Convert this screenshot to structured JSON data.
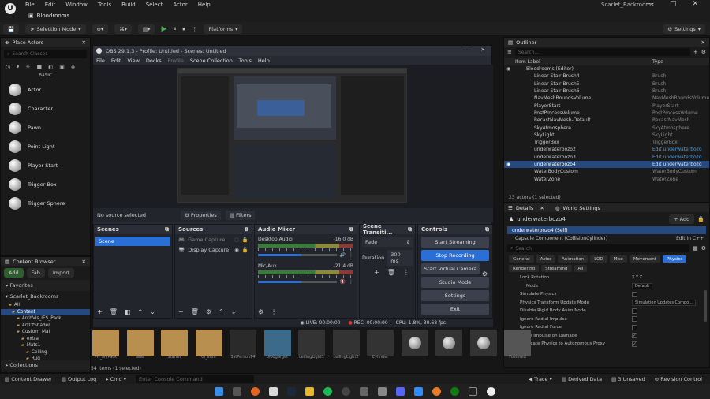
{
  "ue": {
    "logo": "U",
    "menu": [
      "File",
      "Edit",
      "Window",
      "Tools",
      "Build",
      "Select",
      "Actor",
      "Help"
    ],
    "project_tab": "Bloodrooms",
    "window_title": "Scarlet_Backrooms",
    "toolbar": {
      "selection_mode": "Selection Mode",
      "platforms": "Platforms",
      "settings": "Settings"
    }
  },
  "place_actors": {
    "title": "Place Actors",
    "search_placeholder": "Search Classes",
    "category": "BASIC",
    "items": [
      "Actor",
      "Character",
      "Pawn",
      "Point Light",
      "Player Start",
      "Trigger Box",
      "Trigger Sphere"
    ]
  },
  "content_browser": {
    "title": "Content Browser",
    "add": "Add",
    "fab": "Fab",
    "import": "Import",
    "favorites": "Favorites",
    "project": "Scarlet_Backrooms",
    "tree": [
      "All",
      "Content",
      "ArchVis_IES_Pack",
      "ArtOfShader",
      "Custom_Mat",
      "extra",
      "Mats1",
      "Ceiling",
      "Rug"
    ],
    "collections": "Collections",
    "item_count": "54 items (1 selected)",
    "thumb_labels": [
      "PN_IvyPack",
      "ade",
      "Starter",
      "UI_stuff",
      "1stPerson14",
      "biodgarget",
      "ceilingLight1",
      "ceilingLight2",
      "Cylinder",
      "",
      "",
      "",
      "Fostered"
    ]
  },
  "outliner": {
    "title": "Outliner",
    "search_placeholder": "Search...",
    "col_label": "Item Label",
    "col_type": "Type",
    "rows": [
      {
        "label": "Bloodrooms (Editor)",
        "type": ""
      },
      {
        "label": "Linear Stair Brush4",
        "type": "Brush"
      },
      {
        "label": "Linear Stair Brush5",
        "type": "Brush"
      },
      {
        "label": "Linear Stair Brush6",
        "type": "Brush"
      },
      {
        "label": "NavMeshBoundsVolume",
        "type": "NavMeshBoundsVolume"
      },
      {
        "label": "PlayerStart",
        "type": "PlayerStart"
      },
      {
        "label": "PostProcessVolume",
        "type": "PostProcessVolume"
      },
      {
        "label": "RecastNavMesh-Default",
        "type": "RecastNavMesh"
      },
      {
        "label": "SkyAtmosphere",
        "type": "SkyAtmosphere"
      },
      {
        "label": "SkyLight",
        "type": "SkyLight"
      },
      {
        "label": "TriggerBox",
        "type": "TriggerBox"
      },
      {
        "label": "underwaterbozo2",
        "type": "Edit underwaterbozo"
      },
      {
        "label": "underwaterbozo3",
        "type": "Edit underwaterbozo"
      },
      {
        "label": "underwaterbozo4",
        "type": "Edit underwaterbozo"
      },
      {
        "label": "WaterBodyCustom",
        "type": "WaterBodyCustom"
      },
      {
        "label": "WaterZone",
        "type": "WaterZone"
      }
    ],
    "footer": "23 actors (1 selected)"
  },
  "details": {
    "tab_details": "Details",
    "tab_world": "World Settings",
    "object": "underwaterbozo4",
    "add": "+ Add",
    "self": "underwaterbozo4 (Self)",
    "component": "Capsule Component (CollisionCylinder)",
    "edit_cpp": "Edit in C++",
    "search_placeholder": "Search",
    "tabs1": [
      "General",
      "Actor",
      "Animation",
      "LOD",
      "Misc",
      "Movement",
      "Physics"
    ],
    "tabs2": [
      "Rendering",
      "Streaming",
      "All"
    ],
    "props": [
      {
        "name": "Lock Rotation",
        "value": "X  Y  Z"
      },
      {
        "name": "Mode",
        "value": "Default"
      },
      {
        "name": "Simulate Physics",
        "value": ""
      },
      {
        "name": "Physics Transform Update Mode",
        "value": "Simulation Updates Compo..."
      },
      {
        "name": "Disable Rigid Body Anim Node",
        "value": ""
      },
      {
        "name": "Ignore Radial Impulse",
        "value": ""
      },
      {
        "name": "Ignore Radial Force",
        "value": ""
      },
      {
        "name": "Apply Impulse on Damage",
        "value": ""
      },
      {
        "name": "Replicate Physics to Autonomous Proxy",
        "value": ""
      }
    ]
  },
  "obs": {
    "title": "OBS 29.1.3 - Profile: Untitled - Scenes: Untitled",
    "menu": [
      "File",
      "Edit",
      "View",
      "Docks",
      "Profile",
      "Scene Collection",
      "Tools",
      "Help"
    ],
    "no_source": "No source selected",
    "properties": "Properties",
    "filters": "Filters",
    "scenes": {
      "title": "Scenes",
      "items": [
        "Scene"
      ]
    },
    "sources": {
      "title": "Sources",
      "items": [
        "Game Capture",
        "Display Capture"
      ]
    },
    "mixer": {
      "title": "Audio Mixer",
      "channels": [
        {
          "name": "Desktop Audio",
          "db": "-16.0 dB"
        },
        {
          "name": "Mic/Aux",
          "db": "-21.4 dB"
        }
      ]
    },
    "transitions": {
      "title": "Scene Transiti...",
      "type": "Fade",
      "duration_label": "Duration",
      "duration": "300 ms"
    },
    "controls": {
      "title": "Controls",
      "buttons": [
        "Start Streaming",
        "Stop Recording",
        "Start Virtual Camera",
        "Studio Mode",
        "Settings",
        "Exit"
      ]
    },
    "status": {
      "live": "LIVE: 00:00:00",
      "rec": "REC: 00:00:00",
      "cpu": "CPU: 1.8%, 30.68 fps"
    }
  },
  "statusline": {
    "drawer": "Content Drawer",
    "output": "Output Log",
    "cmd": "Cmd",
    "console_placeholder": "Enter Console Command",
    "trace": "Trace",
    "derived": "Derived Data",
    "unsaved": "3 Unsaved",
    "revision": "Revision Control"
  },
  "colors": {
    "accent": "#2a6fd6",
    "selection": "#264a80",
    "obs_bg": "#272a33"
  }
}
